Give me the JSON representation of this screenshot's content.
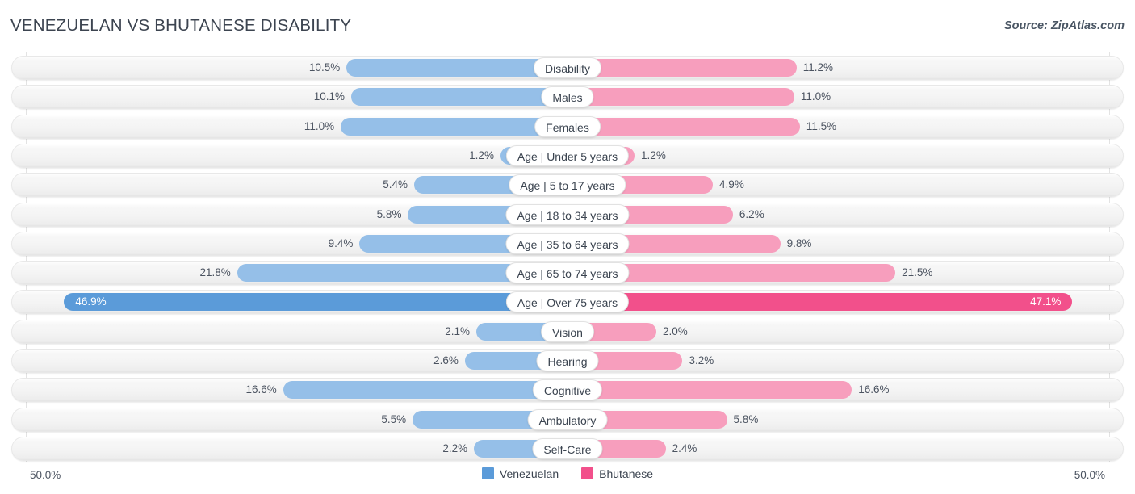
{
  "header": {
    "title": "VENEZUELAN VS BHUTANESE DISABILITY",
    "source": "Source: ZipAtlas.com"
  },
  "axis": {
    "left_label": "50.0%",
    "right_label": "50.0%",
    "max": 50.0
  },
  "legend": {
    "items": [
      {
        "label": "Venezuelan",
        "color": "#5b9bd9"
      },
      {
        "label": "Bhutanese",
        "color": "#f2508b"
      }
    ]
  },
  "colors": {
    "blue_light": "#95bfe8",
    "blue_strong": "#5b9bd9",
    "pink_light": "#f79ebd",
    "pink_strong": "#f2508b",
    "track": "#f4f4f4",
    "gridline": "#e3e3e3"
  },
  "chart_data": {
    "type": "bar",
    "orientation": "horizontal-diverging",
    "title": "VENEZUELAN VS BHUTANESE DISABILITY",
    "xlabel": "",
    "ylabel": "",
    "xlim": [
      -50.0,
      50.0
    ],
    "grid": true,
    "legend_position": "bottom-center",
    "categories": [
      "Disability",
      "Males",
      "Females",
      "Age | Under 5 years",
      "Age | 5 to 17 years",
      "Age | 18 to 34 years",
      "Age | 35 to 64 years",
      "Age | 65 to 74 years",
      "Age | Over 75 years",
      "Vision",
      "Hearing",
      "Cognitive",
      "Ambulatory",
      "Self-Care"
    ],
    "series": [
      {
        "name": "Venezuelan",
        "side": "left",
        "values": [
          10.5,
          10.1,
          11.0,
          1.2,
          5.4,
          5.8,
          9.4,
          21.8,
          46.9,
          2.1,
          2.6,
          16.6,
          5.5,
          2.2
        ],
        "labels": [
          "10.5%",
          "10.1%",
          "11.0%",
          "1.2%",
          "5.4%",
          "5.8%",
          "9.4%",
          "21.8%",
          "46.9%",
          "2.1%",
          "2.6%",
          "16.6%",
          "5.5%",
          "2.2%"
        ]
      },
      {
        "name": "Bhutanese",
        "side": "right",
        "values": [
          11.2,
          11.0,
          11.5,
          1.2,
          4.9,
          6.2,
          9.8,
          21.5,
          47.1,
          2.0,
          3.2,
          16.6,
          5.8,
          2.4
        ],
        "labels": [
          "11.2%",
          "11.0%",
          "11.5%",
          "1.2%",
          "4.9%",
          "6.2%",
          "9.8%",
          "21.5%",
          "47.1%",
          "2.0%",
          "3.2%",
          "16.6%",
          "5.8%",
          "2.4%"
        ]
      }
    ],
    "highlight_row_index": 8
  }
}
